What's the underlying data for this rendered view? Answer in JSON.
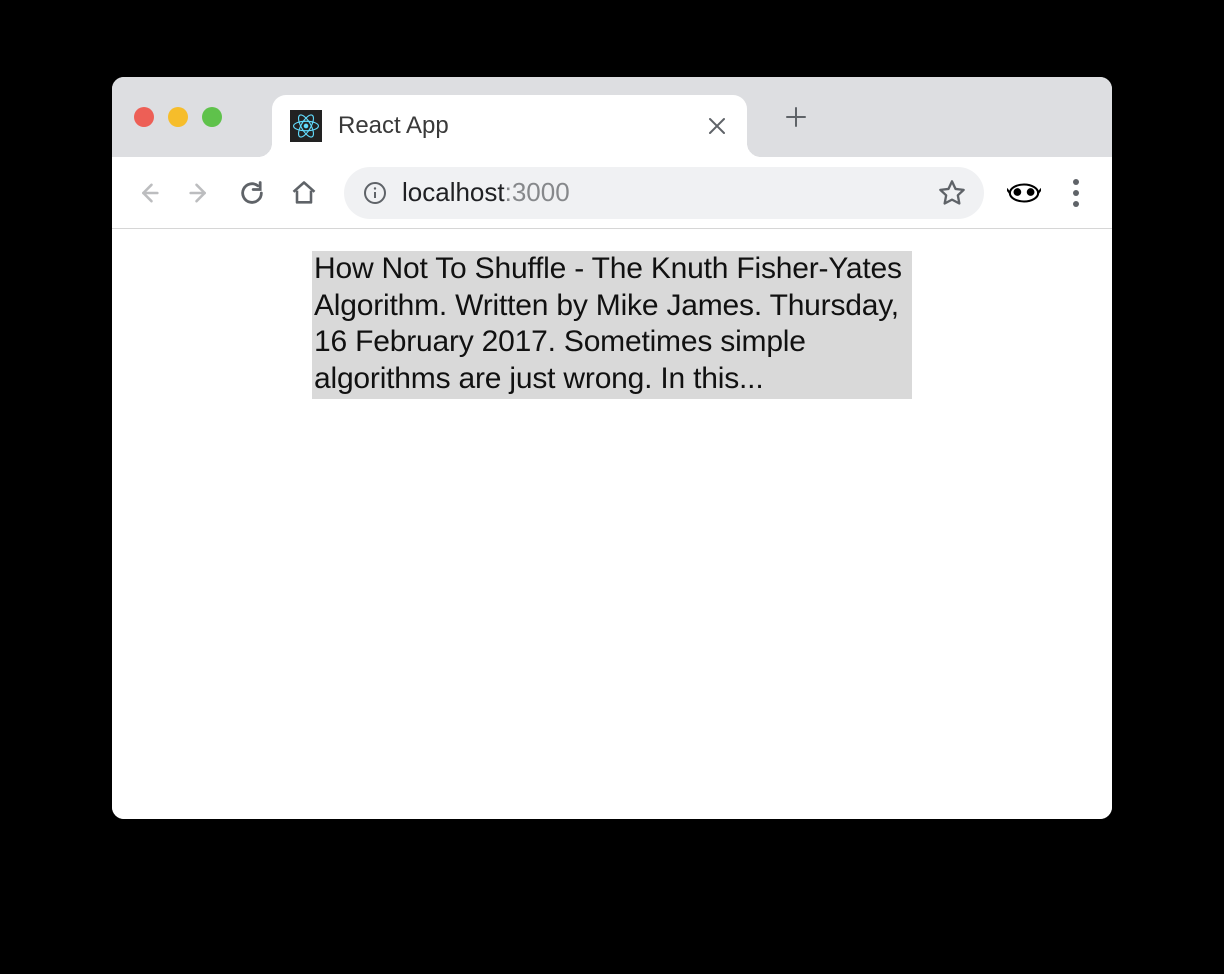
{
  "browser": {
    "tab_title": "React App",
    "url_host": "localhost",
    "url_port": ":3000"
  },
  "page": {
    "paragraph": "How Not To Shuffle - The Knuth Fisher-Yates Algorithm. Written by Mike James. Thursday, 16 February 2017. Sometimes simple algorithms are just wrong. In this..."
  }
}
